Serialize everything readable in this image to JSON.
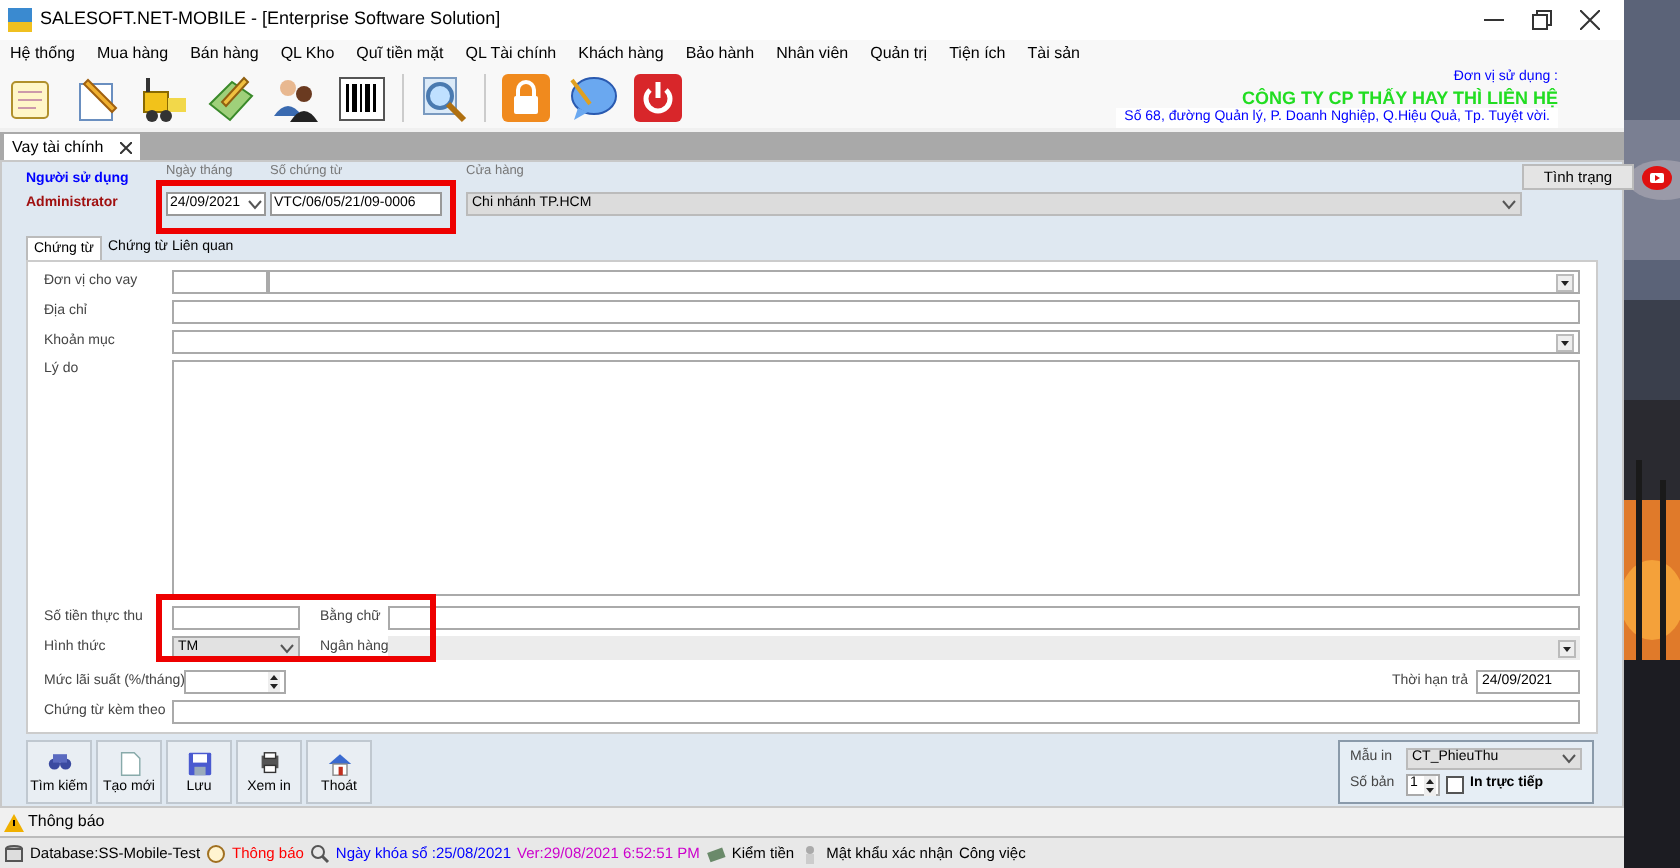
{
  "window": {
    "title": "SALESOFT.NET-MOBILE - [Enterprise Software Solution]"
  },
  "menu": [
    "Hệ thống",
    "Mua hàng",
    "Bán hàng",
    "QL Kho",
    "Quĩ tiền mặt",
    "QL Tài chính",
    "Khách hàng",
    "Bảo hành",
    "Nhân viên",
    "Quản trị",
    "Tiện ích",
    "Tài sản"
  ],
  "company": {
    "caption": "Đơn vị sử dụng :",
    "name": "CÔNG TY CP THẤY HAY THÌ LIÊN HỆ",
    "address": "Số 68, đường Quản lý, P. Doanh Nghiệp,  Q.Hiệu Quả, Tp. Tuyệt vời."
  },
  "doc_tabs": [
    {
      "label": "Vay tài chính",
      "selected": true
    }
  ],
  "header": {
    "user_label": "Người sử dụng",
    "user": "Administrator",
    "date_label": "Ngày tháng",
    "date": "24/09/2021",
    "number_label": "Số chứng từ",
    "number": "VTC/06/05/21/09-0006",
    "store_label": "Cửa hàng",
    "store": "Chi nhánh TP.HCM",
    "status_button": "Tình trạng"
  },
  "sub_tabs": [
    {
      "label": "Chứng từ",
      "selected": true
    },
    {
      "label": "Chứng từ Liên quan",
      "selected": false
    }
  ],
  "form": {
    "lender_label": "Đơn vị cho vay",
    "address_label": "Địa chỉ",
    "category_label": "Khoản mục",
    "reason_label": "Lý do",
    "amount_label": "Số tiền thực thu",
    "in_words_label": "Bằng chữ",
    "method_label": "Hình thức",
    "method": "TM",
    "bank_label": "Ngân hàng",
    "rate_label": "Mức lãi suất (%/tháng)",
    "due_label": "Thời hạn trả",
    "due": "24/09/2021",
    "attachments_label": "Chứng từ kèm theo"
  },
  "actions": [
    {
      "label": "Tìm kiếm",
      "kind": "search"
    },
    {
      "label": "Tạo mới",
      "kind": "new"
    },
    {
      "label": "Lưu",
      "kind": "save"
    },
    {
      "label": "Xem in",
      "kind": "preview"
    },
    {
      "label": "Thoát",
      "kind": "exit"
    }
  ],
  "print": {
    "template_label": "Mẫu in",
    "template": "CT_PhieuThu",
    "copies_label": "Số bản",
    "copies": "1",
    "direct_label": "In trực tiếp",
    "direct_checked": false
  },
  "notice": "Thông báo",
  "status_bar": [
    {
      "text": "Database:SS-Mobile-Test",
      "kind": "database",
      "color": "#000000"
    },
    {
      "text": "Thông báo",
      "kind": "notice",
      "color": "#ff0000"
    },
    {
      "text": "Ngày khóa sổ :25/08/2021",
      "kind": "lock",
      "color": "#0000ff"
    },
    {
      "text": "Ver:29/08/2021 6:52:51 PM",
      "kind": "plain",
      "color": "#cc00cc"
    },
    {
      "text": "Kiểm tiền",
      "kind": "money",
      "color": "#000000"
    },
    {
      "text": "Mật khẩu xác nhận",
      "kind": "person",
      "color": "#000000"
    },
    {
      "text": "Công việc",
      "kind": "plain",
      "color": "#000000"
    }
  ]
}
